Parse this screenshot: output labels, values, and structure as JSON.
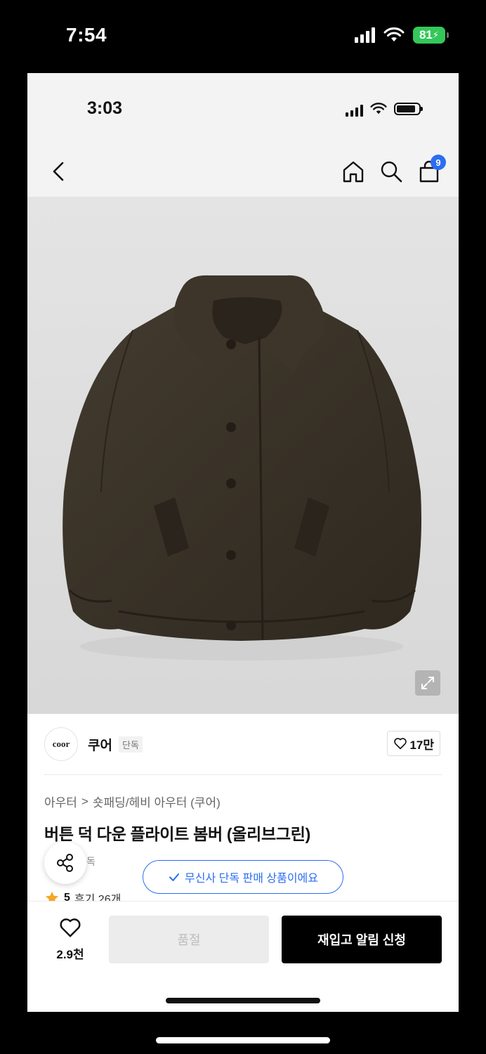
{
  "outer_status": {
    "time": "7:54",
    "battery": "81"
  },
  "inner_status": {
    "time": "3:03"
  },
  "nav": {
    "cart_count": "9"
  },
  "brand": {
    "logo_text": "coor",
    "name": "쿠어",
    "tag": "단독",
    "likes": "17만"
  },
  "breadcrumb": {
    "category": "아우터",
    "separator": ">",
    "subcategory": "숏패딩/헤비 아우터 (쿠어)"
  },
  "product": {
    "title": "버튼 덕 다운 플라이트 봄버 (올리브그린)",
    "partial_tag": "독",
    "exclusive_notice": "무신사 단독 판매 상품이에요",
    "rating": "5",
    "reviews": "후기 26개"
  },
  "bottom": {
    "wish_count": "2.9천",
    "soldout_label": "품절",
    "restock_label": "재입고 알림 신청"
  },
  "colors": {
    "accent": "#2b6df2",
    "jacket": "#3a3328",
    "battery": "#34c759",
    "star": "#f5a623"
  }
}
